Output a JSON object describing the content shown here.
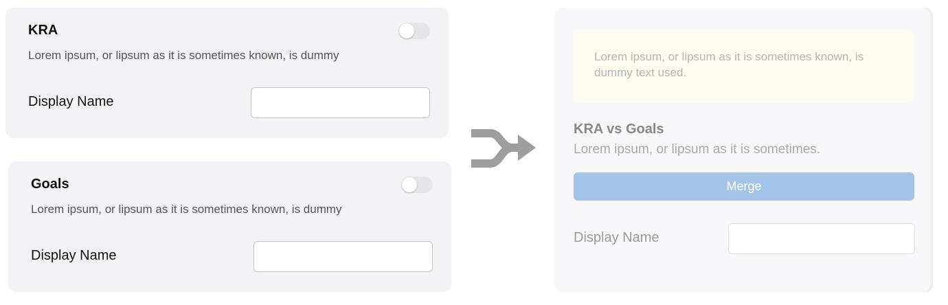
{
  "cards": [
    {
      "title": "KRA",
      "description": "Lorem ipsum, or lipsum as it is sometimes known, is dummy",
      "field_label": "Display Name",
      "field_value": "",
      "toggle_on": false
    },
    {
      "title": "Goals",
      "description": "Lorem ipsum, or lipsum as it is sometimes known, is dummy",
      "field_label": "Display Name",
      "field_value": "",
      "toggle_on": false
    }
  ],
  "merge_icon": "merge-arrow-icon",
  "result": {
    "note": "Lorem ipsum, or lipsum as it is sometimes known, is dummy text used.",
    "title": "KRA vs Goals",
    "description": "Lorem ipsum, or lipsum as it is sometimes.",
    "merge_button_label": "Merge",
    "field_label": "Display Name",
    "field_value": ""
  },
  "colors": {
    "card_background": "#f3f2f7",
    "merge_button": "#a3c4e8",
    "note_background": "#fdfcef",
    "arrow": "#9e9e9e"
  }
}
